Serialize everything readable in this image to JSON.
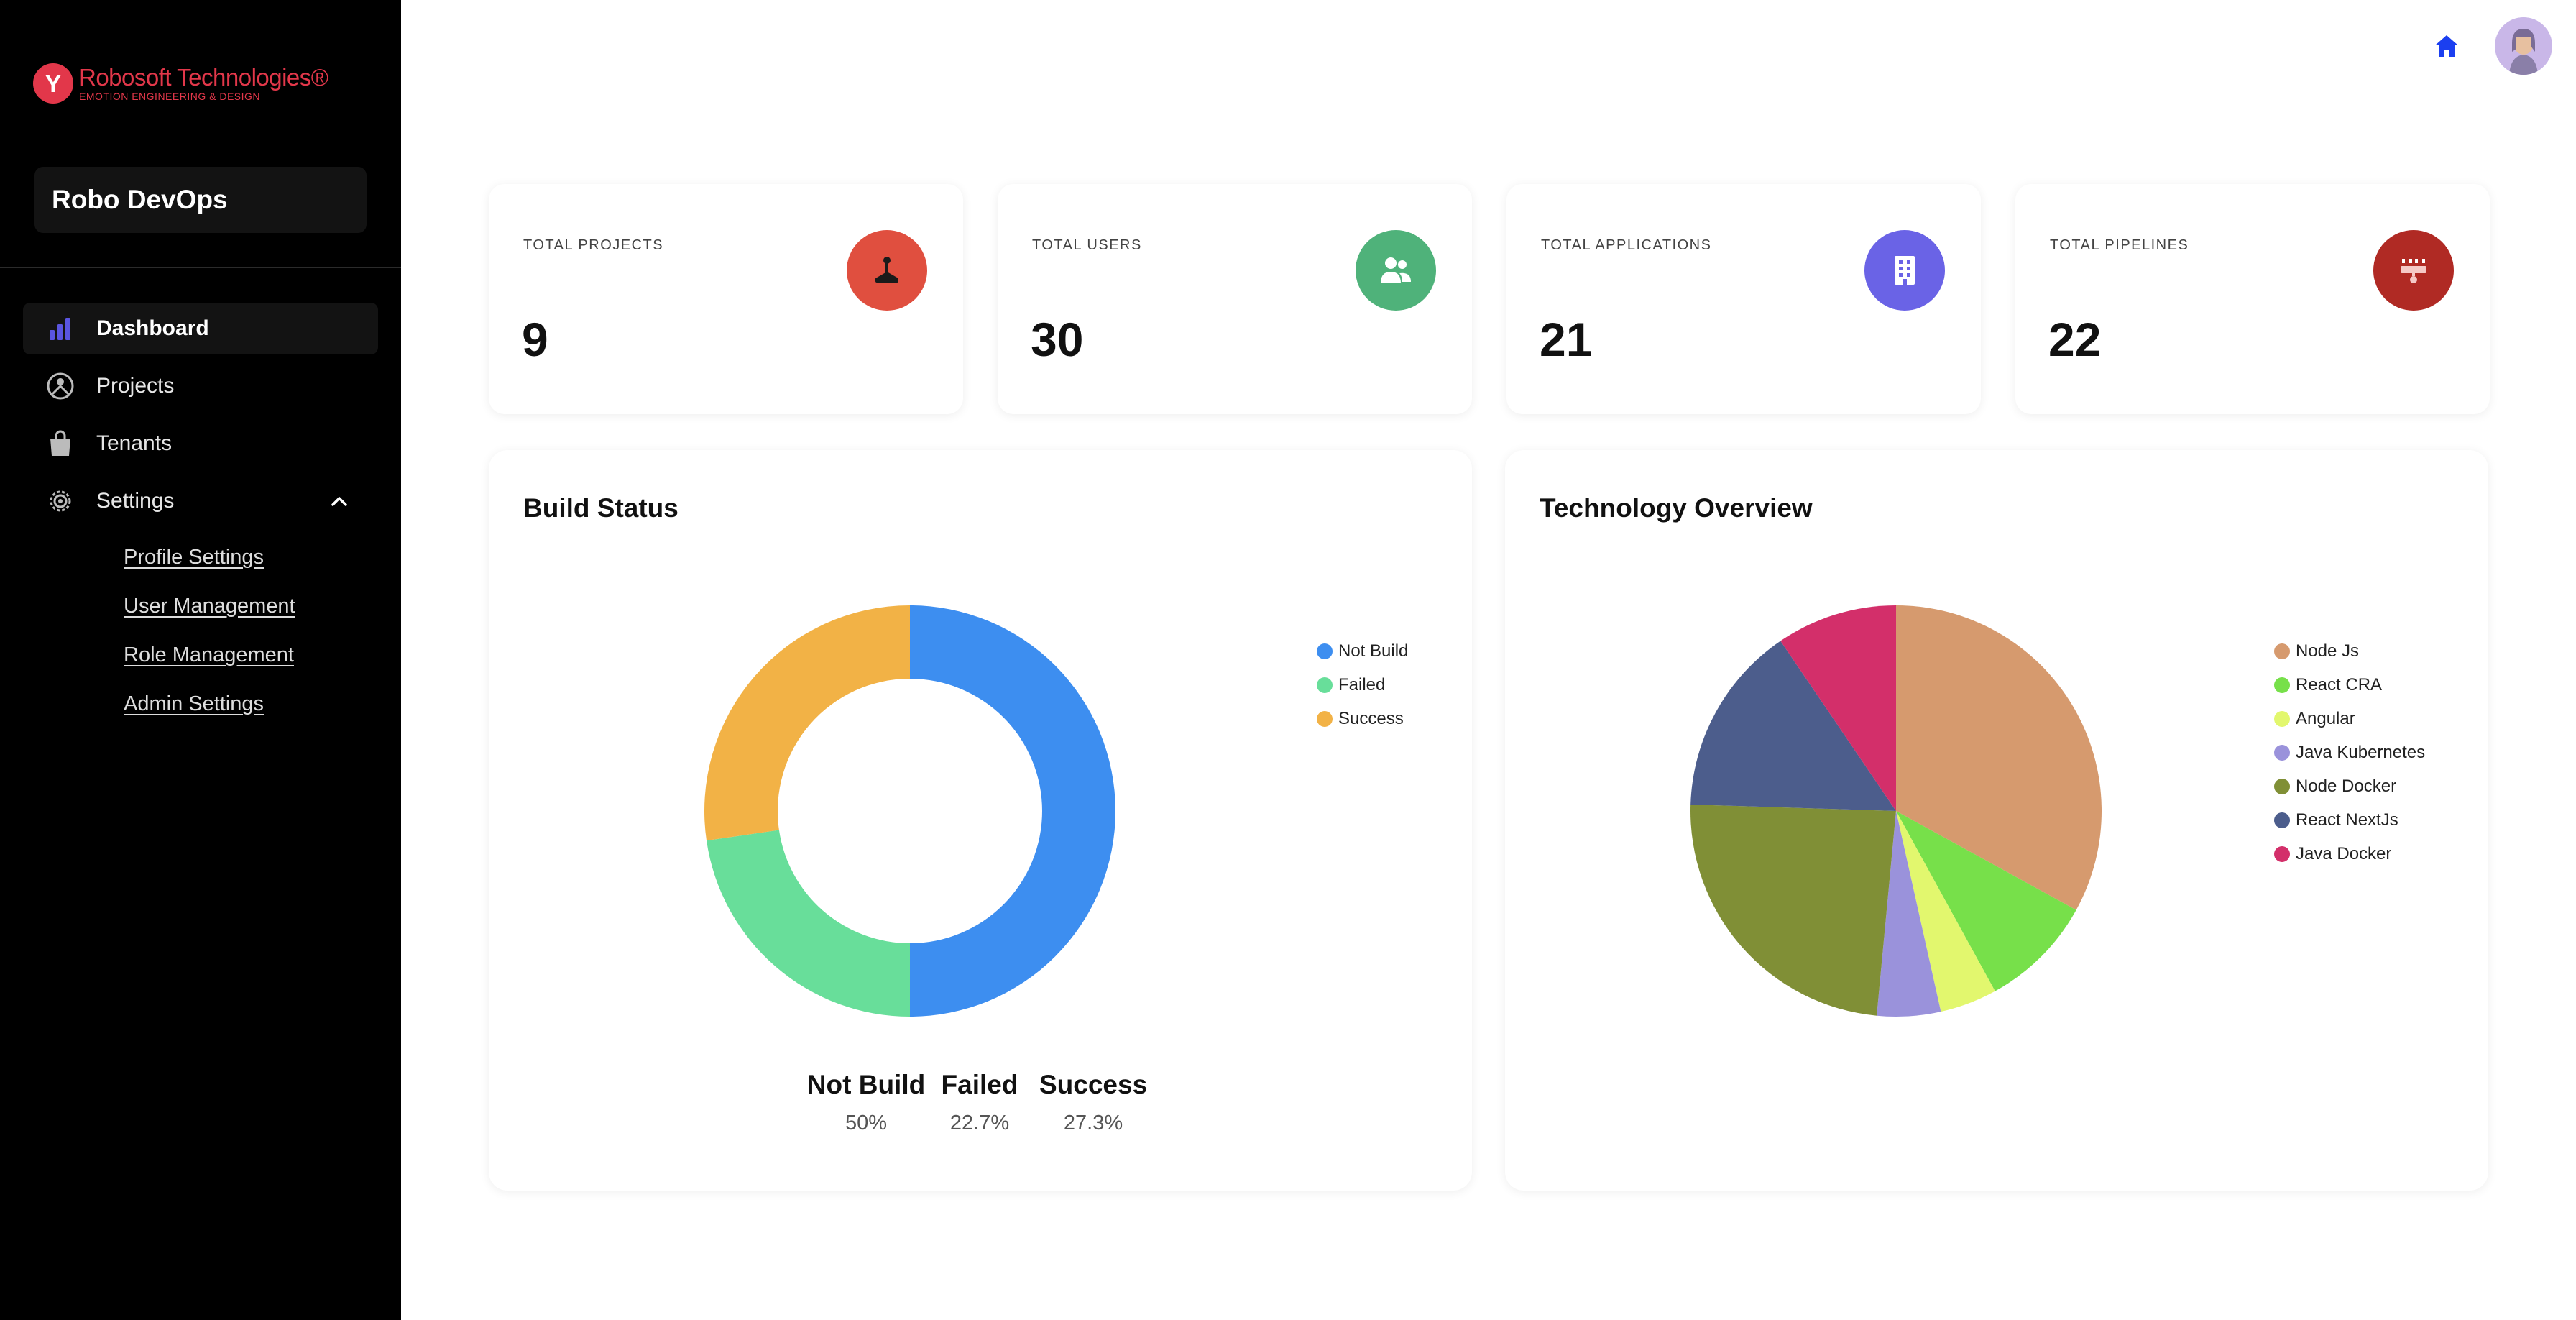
{
  "sidebar": {
    "logo": {
      "name": "Robosoft Technologies®",
      "tagline": "EMOTION ENGINEERING & DESIGN",
      "mark": "Y"
    },
    "app_name": "Robo DevOps",
    "nav": [
      {
        "label": "Dashboard",
        "icon": "bar-chart-icon",
        "active": true
      },
      {
        "label": "Projects",
        "icon": "projects-icon",
        "active": false
      },
      {
        "label": "Tenants",
        "icon": "shopping-bag-icon",
        "active": false
      },
      {
        "label": "Settings",
        "icon": "gear-icon",
        "active": false,
        "expanded": true
      }
    ],
    "settings_sub": [
      "Profile Settings",
      "User Management",
      "Role Management",
      "Admin Settings"
    ]
  },
  "topbar": {
    "home_icon": "home-icon",
    "avatar": "user-avatar"
  },
  "stats": [
    {
      "label": "TOTAL PROJECTS",
      "value": "9",
      "icon": "joystick-icon",
      "color": "#e04f3f"
    },
    {
      "label": "TOTAL USERS",
      "value": "30",
      "icon": "users-icon",
      "color": "#4fb27a"
    },
    {
      "label": "TOTAL APPLICATIONS",
      "value": "21",
      "icon": "building-icon",
      "color": "#6a63e6"
    },
    {
      "label": "TOTAL PIPELINES",
      "value": "22",
      "icon": "pipeline-icon",
      "color": "#b02a24"
    }
  ],
  "build_status": {
    "title": "Build Status",
    "summary": [
      {
        "label": "Not Build",
        "pct": "50%"
      },
      {
        "label": "Failed",
        "pct": "22.7%"
      },
      {
        "label": "Success",
        "pct": "27.3%"
      }
    ]
  },
  "technology_overview": {
    "title": "Technology Overview"
  },
  "chart_data": [
    {
      "type": "pie",
      "variant": "donut",
      "title": "Build Status",
      "legend_position": "right",
      "categories": [
        "Not Build",
        "Failed",
        "Success"
      ],
      "values": [
        50,
        22.7,
        27.3
      ],
      "colors": [
        "#3d8ef0",
        "#68de9a",
        "#f2b246"
      ]
    },
    {
      "type": "pie",
      "title": "Technology Overview",
      "legend_position": "right",
      "categories": [
        "Node Js",
        "React CRA",
        "Angular",
        "Java Kubernetes",
        "Node Docker",
        "React NextJs",
        "Java Docker"
      ],
      "values": [
        33,
        9,
        4.5,
        5,
        24,
        15,
        9.5
      ],
      "colors": [
        "#d69a6e",
        "#77e04a",
        "#e2f76e",
        "#9a92db",
        "#808f36",
        "#4c5d8c",
        "#d32f6a"
      ]
    }
  ]
}
